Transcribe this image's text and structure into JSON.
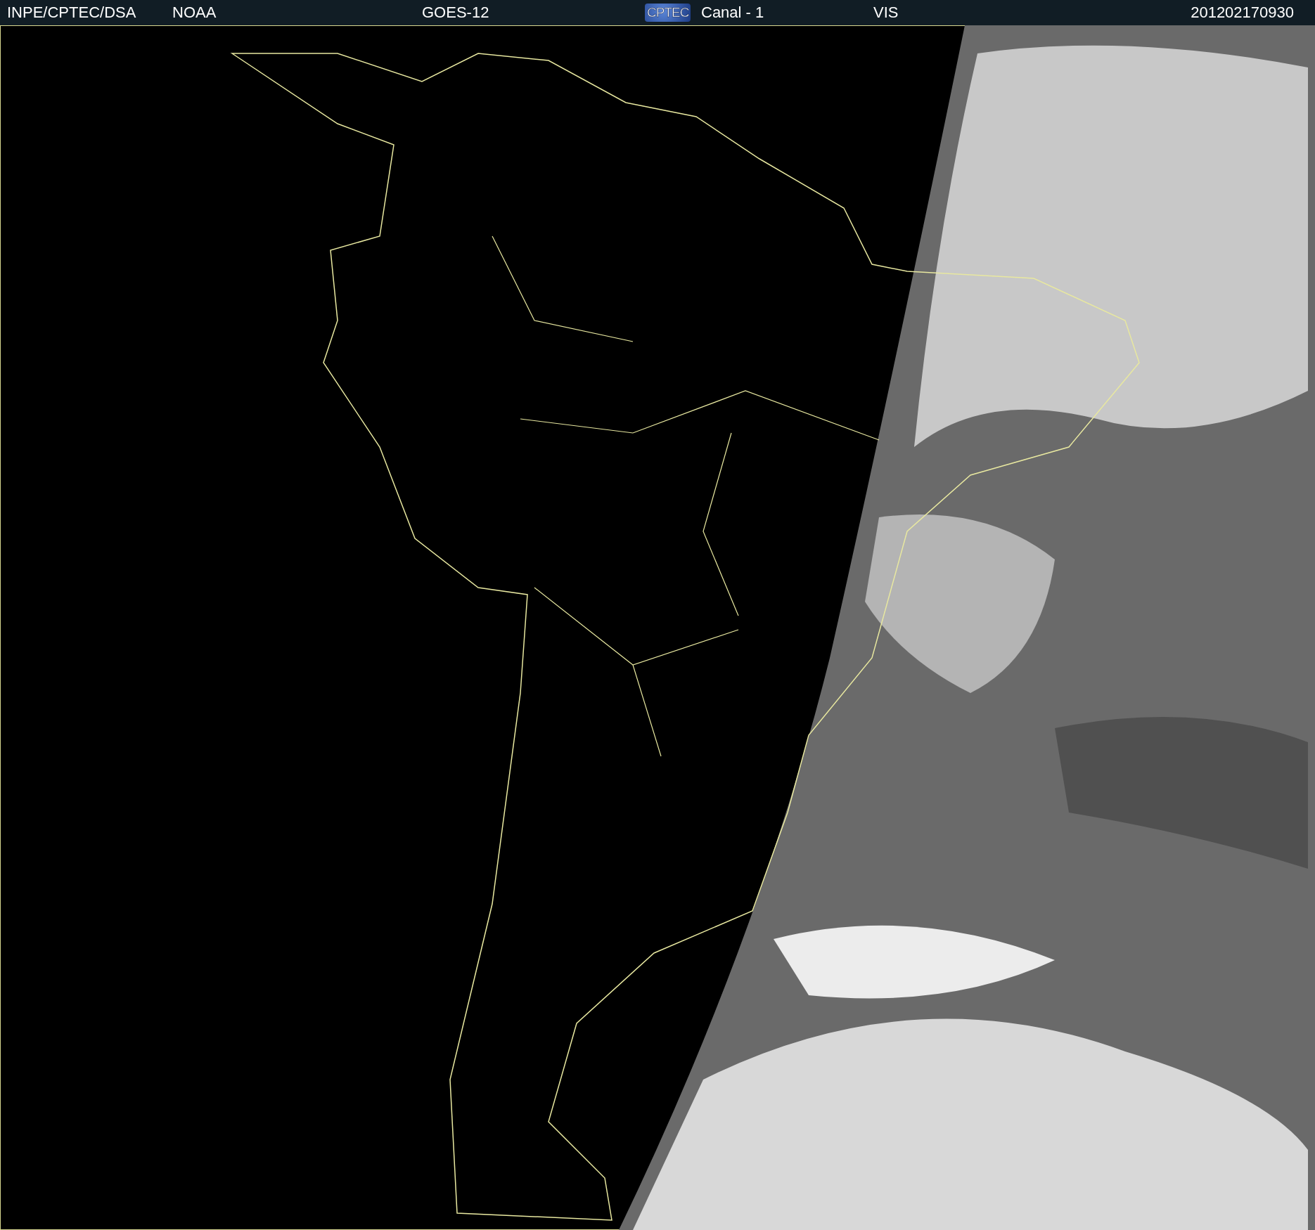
{
  "header": {
    "source": "INPE/CPTEC/DSA",
    "agency": "NOAA",
    "satellite": "GOES-12",
    "logo": "CPTEC",
    "channel": "Canal - 1",
    "band": "VIS",
    "timestamp": "201202170930"
  }
}
